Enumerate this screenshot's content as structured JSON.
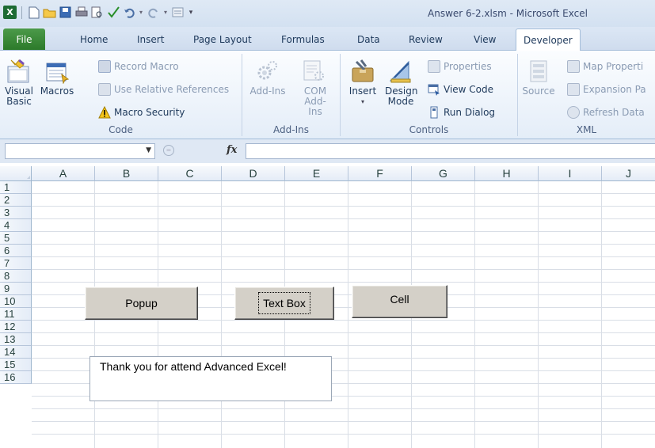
{
  "window": {
    "title": "Answer 6-2.xlsm - Microsoft Excel",
    "app_icon": "X"
  },
  "tabs": [
    {
      "label": "File"
    },
    {
      "label": "Home"
    },
    {
      "label": "Insert"
    },
    {
      "label": "Page Layout"
    },
    {
      "label": "Formulas"
    },
    {
      "label": "Data"
    },
    {
      "label": "Review"
    },
    {
      "label": "View"
    },
    {
      "label": "Developer",
      "active": true
    }
  ],
  "ribbon": {
    "code": {
      "label": "Code",
      "visual_basic": "Visual Basic",
      "macros": "Macros",
      "record_macro": "Record Macro",
      "use_relative_references": "Use Relative References",
      "macro_security": "Macro Security"
    },
    "addins": {
      "label": "Add-Ins",
      "addins": "Add-Ins",
      "com_addins": "COM Add-Ins"
    },
    "controls": {
      "label": "Controls",
      "insert": "Insert",
      "design_mode": "Design Mode",
      "properties": "Properties",
      "view_code": "View Code",
      "run_dialog": "Run Dialog"
    },
    "xml": {
      "label": "XML",
      "source": "Source",
      "map_properties": "Map Properti",
      "expansion_packs": "Expansion Pa",
      "refresh_data": "Refresh Data"
    }
  },
  "formula_bar": {
    "name_box": "",
    "fx_label": "fx",
    "formula": ""
  },
  "sheet": {
    "columns": [
      "A",
      "B",
      "C",
      "D",
      "E",
      "F",
      "G",
      "H",
      "I",
      "J"
    ],
    "rows": [
      "1",
      "2",
      "3",
      "4",
      "5",
      "6",
      "7",
      "8",
      "9",
      "10",
      "11",
      "12",
      "13",
      "14",
      "15",
      "16"
    ]
  },
  "controls": {
    "popup_button": "Popup",
    "textbox_button": "Text Box",
    "cell_button": "Cell",
    "textbox_value": "Thank you for attend Advanced Excel!"
  },
  "colors": {
    "file_tab": "#2c7a2a",
    "ribbon_bg": "#e4edf8",
    "form_button": "#d4d0c8"
  }
}
